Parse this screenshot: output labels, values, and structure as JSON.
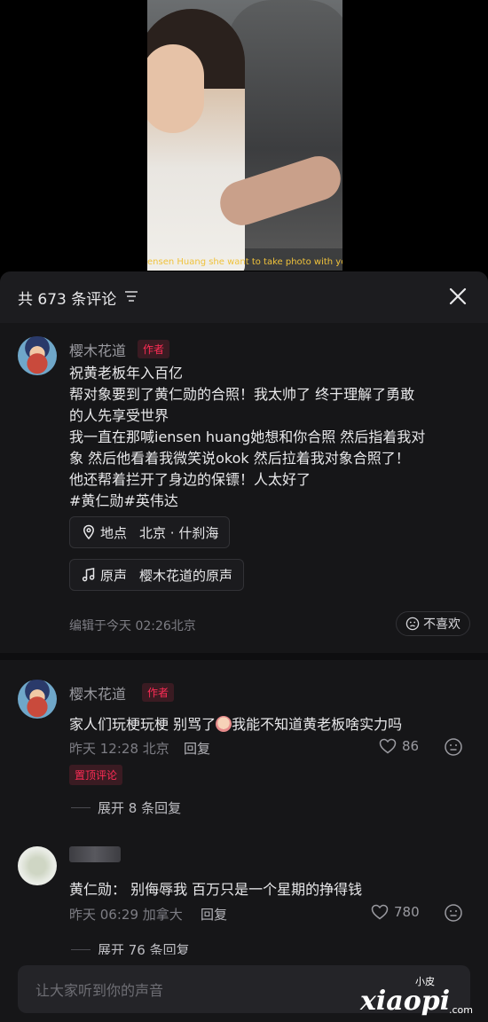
{
  "video": {
    "caption": "ensen Huang she want to take photo with yo"
  },
  "header": {
    "title": "共 673 条评论"
  },
  "comment1": {
    "username": "樱木花道",
    "author_badge": "作者",
    "lines": [
      "祝黄老板年入百亿",
      "帮对象要到了黄仁勋的合照！我太帅了 终于理解了勇敢",
      "的人先享受世界",
      "我一直在那喊iensen huang她想和你合照 然后指着我对",
      "象 然后他看着我微笑说okok 然后拉着我对象合照了！",
      "他还帮着拦开了身边的保镖！人太好了",
      "#黄仁勋#英伟达"
    ],
    "location_label": "地点",
    "location_value": "北京 · 什刹海",
    "sound_label": "原声",
    "sound_value": "樱木花道的原声",
    "edited": "编辑于今天 02:26北京",
    "dislike_label": "不喜欢"
  },
  "comment2": {
    "username": "樱木花道",
    "author_badge": "作者",
    "text_before": "家人们玩梗玩梗 别骂了",
    "text_after": "我能不知道黄老板啥实力吗",
    "time": "昨天 12:28 北京",
    "reply_label": "回复",
    "likes": "86",
    "pinned_label": "置顶评论",
    "expand_label": "展开 8 条回复"
  },
  "comment3": {
    "text": "黄仁勋： 别侮辱我 百万只是一个星期的挣得钱",
    "time": "昨天 06:29 加拿大",
    "reply_label": "回复",
    "likes": "780",
    "expand_label": "展开 76 条回复"
  },
  "input": {
    "placeholder": "让大家听到你的声音"
  },
  "watermark": {
    "small": "小皮",
    "text": "xiaopi",
    "domain": ".com"
  },
  "colors": {
    "accent": "#fe2c55",
    "panel_bg": "#161618",
    "text_primary": "#e8e8ea",
    "text_secondary": "#7d7d84"
  }
}
